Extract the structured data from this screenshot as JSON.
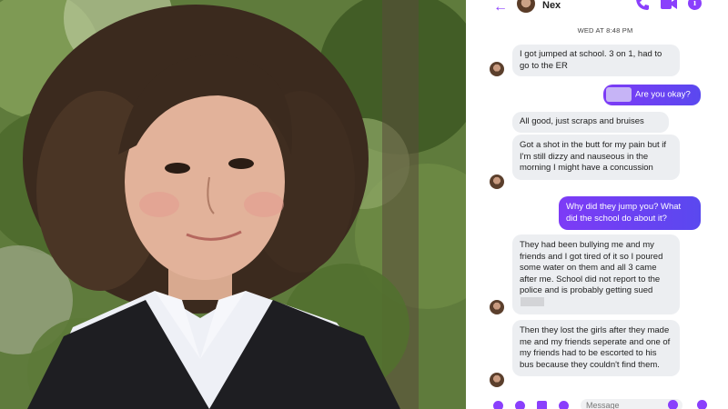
{
  "photo": {
    "subject": "portrait-photo"
  },
  "chat": {
    "header": {
      "contact_name": "Nex"
    },
    "timestamp": "WED AT 8:48 PM",
    "messages": [
      {
        "from": "them",
        "text": "I got jumped at school. 3 on 1, had to go to the ER"
      },
      {
        "from": "me",
        "text": "Are you okay?"
      },
      {
        "from": "them",
        "text": "All good, just scraps and bruises"
      },
      {
        "from": "them",
        "text": "Got a shot in the butt for my pain but if I'm still dizzy and nauseous in the morning I might have a concussion"
      },
      {
        "from": "me",
        "text": "Why did they jump you? What did the school do about it?"
      },
      {
        "from": "them",
        "text": "They had been bullying me and my friends and I got tired of it so I poured some water on them and all 3 came after me. School did not report to the police and is probably getting sued"
      },
      {
        "from": "them",
        "text": "Then they lost the girls after they made me and my friends seperate and one of my friends had to be escorted to his bus because they couldn't find them."
      }
    ],
    "composer": {
      "placeholder": "Message"
    }
  },
  "colors": {
    "accent": "#8a3ffc",
    "outgoing_bubble": "#6a44f3",
    "incoming_bubble": "#eceef1"
  }
}
